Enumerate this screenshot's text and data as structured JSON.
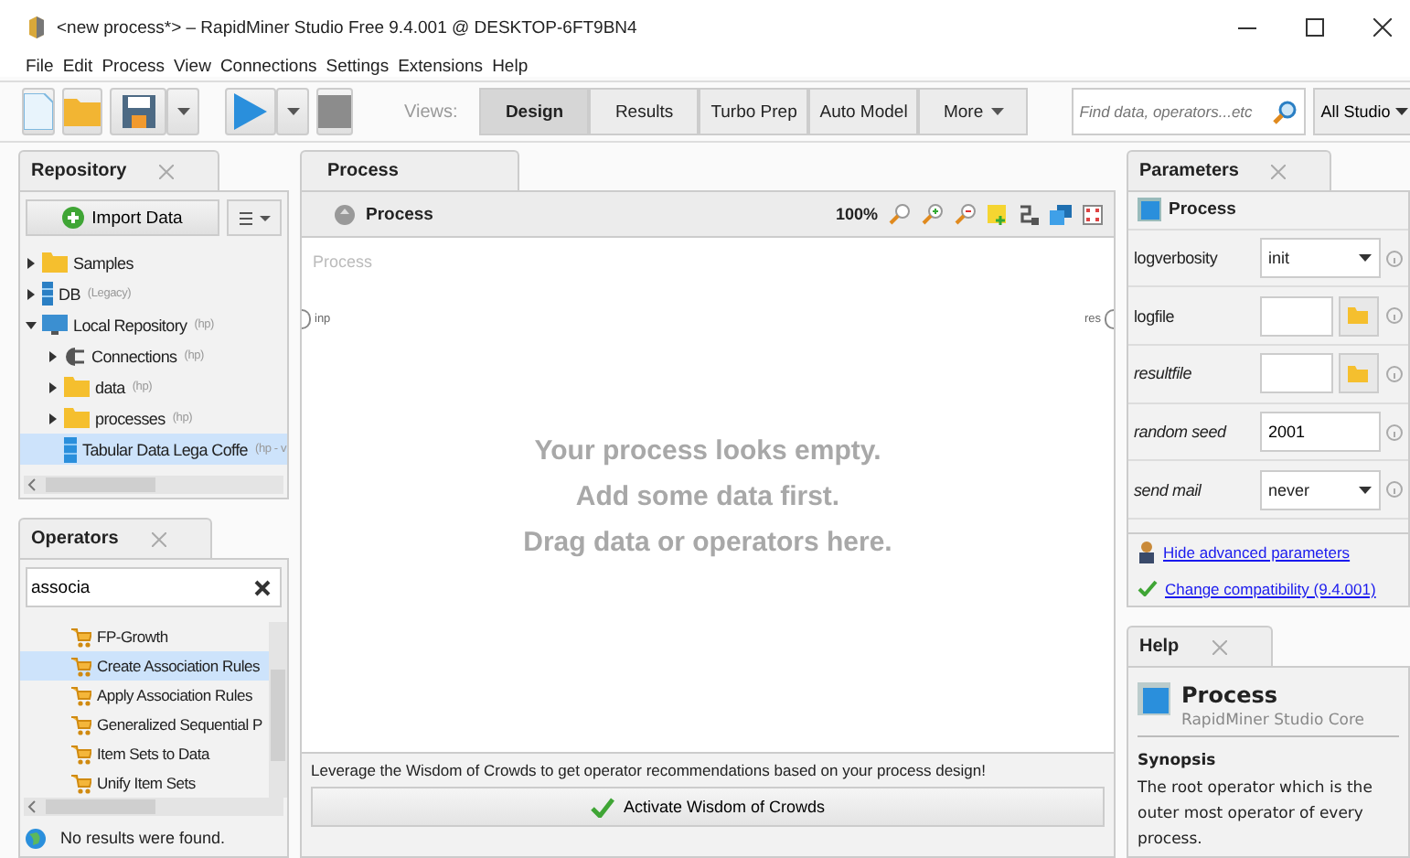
{
  "window": {
    "title": "<new process*> – RapidMiner Studio Free 9.4.001 @ DESKTOP-6FT9BN4"
  },
  "menu": [
    "File",
    "Edit",
    "Process",
    "View",
    "Connections",
    "Settings",
    "Extensions",
    "Help"
  ],
  "toolbar": {
    "views_label": "Views:",
    "views": [
      {
        "label": "Design",
        "selected": true
      },
      {
        "label": "Results",
        "selected": false
      },
      {
        "label": "Turbo Prep",
        "selected": false
      },
      {
        "label": "Auto Model",
        "selected": false
      }
    ],
    "more": "More",
    "search": {
      "placeholder": "Find data, operators...etc"
    },
    "scope": "All Studio"
  },
  "repository": {
    "title": "Repository",
    "import_button": "Import Data",
    "items": [
      {
        "label": "Samples",
        "kind": "folder",
        "expanded": false,
        "selected": false
      },
      {
        "label": "DB",
        "note": "(Legacy)",
        "kind": "database",
        "expanded": false,
        "selected": false
      },
      {
        "label": "Local Repository",
        "note": "(hp)",
        "kind": "computer",
        "expanded": true,
        "selected": false,
        "children": [
          {
            "label": "Connections",
            "note": "(hp)",
            "kind": "connection",
            "expanded": false,
            "selected": false
          },
          {
            "label": "data",
            "note": "(hp)",
            "kind": "folder",
            "expanded": false,
            "selected": false
          },
          {
            "label": "processes",
            "note": "(hp)",
            "kind": "folder",
            "expanded": false,
            "selected": false
          },
          {
            "label": "Tabular Data Lega Coffe",
            "note": "(hp - v",
            "kind": "table",
            "selected": true
          }
        ]
      }
    ]
  },
  "operators": {
    "title": "Operators",
    "search": {
      "value": "associa"
    },
    "items": [
      {
        "label": "FP-Growth",
        "selected": false
      },
      {
        "label": "Create Association Rules",
        "selected": true
      },
      {
        "label": "Apply Association Rules",
        "selected": false
      },
      {
        "label": "Generalized Sequential P",
        "selected": false
      },
      {
        "label": "Item Sets to Data",
        "selected": false
      },
      {
        "label": "Unify Item Sets",
        "selected": false
      }
    ],
    "status": "No results were found."
  },
  "process": {
    "tab": "Process",
    "breadcrumb": "Process",
    "zoom": "100%",
    "canvas_label": "Process",
    "input_port": "inp",
    "output_port": "res",
    "empty_message": [
      "Your process looks empty.",
      "Add some data first.",
      "Drag data or operators here."
    ],
    "hint": "Leverage the Wisdom of Crowds to get operator recommendations based on your process design!",
    "wisdom_button": "Activate Wisdom of Crowds"
  },
  "parameters": {
    "title": "Parameters",
    "operator": "Process",
    "rows": [
      {
        "label": "logverbosity",
        "kind": "select",
        "value": "init",
        "expert": false
      },
      {
        "label": "logfile",
        "kind": "file",
        "expert": false
      },
      {
        "label": "resultfile",
        "kind": "file",
        "expert": true
      },
      {
        "label": "random seed",
        "kind": "text",
        "value": "2001",
        "expert": true
      },
      {
        "label": "send mail",
        "kind": "select",
        "value": "never",
        "expert": true
      }
    ],
    "links": [
      {
        "label": "Hide advanced parameters",
        "kind": "advanced"
      },
      {
        "label": "Change compatibility (9.4.001)",
        "kind": "compatibility"
      }
    ]
  },
  "help": {
    "title": "Help",
    "operator": "Process",
    "source": "RapidMiner Studio Core",
    "section": "Synopsis",
    "text": "The root operator which is the outer most operator of every process."
  }
}
